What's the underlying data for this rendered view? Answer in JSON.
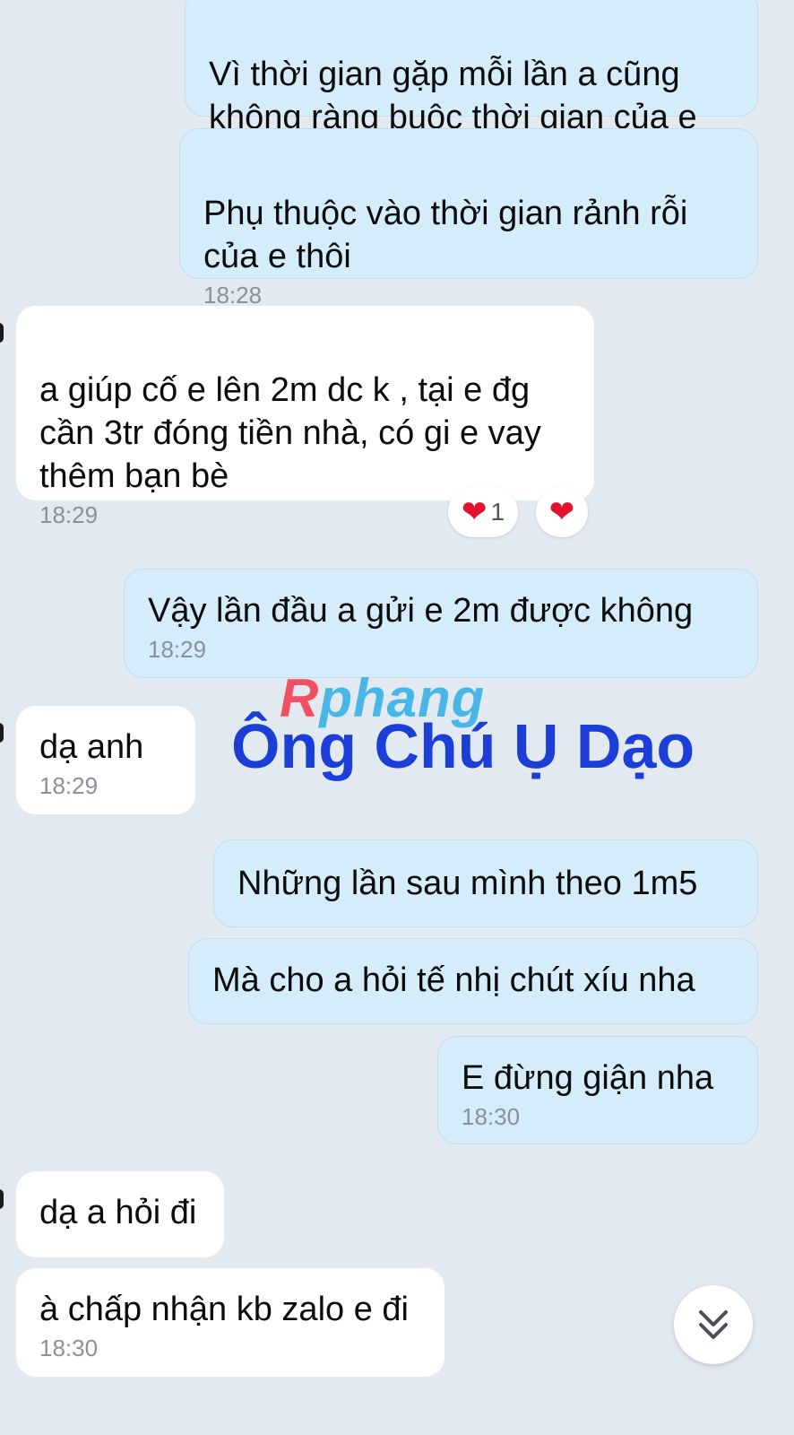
{
  "messages": [
    {
      "text": "Vì thời gian gặp mỗi lần a cũng\nkhông ràng buộc thời gian của e",
      "time": ""
    },
    {
      "text": "Phụ thuộc vào thời gian rảnh rỗi\ncủa e thôi",
      "time": "18:28"
    },
    {
      "text": "a giúp cố e lên 2m dc k , tại e đg\ncần 3tr đóng tiền nhà, có gi e vay\nthêm bạn bè",
      "time": "18:29"
    },
    {
      "text": "Vậy lần đầu a gửi e 2m được không",
      "time": "18:29"
    },
    {
      "text": "dạ anh",
      "time": "18:29"
    },
    {
      "text": "Những lần sau mình theo 1m5",
      "time": ""
    },
    {
      "text": "Mà cho a hỏi tế nhị chút xíu nha",
      "time": ""
    },
    {
      "text": "E đừng giận nha",
      "time": "18:30"
    },
    {
      "text": "dạ a hỏi đi",
      "time": ""
    },
    {
      "text": "à chấp nhận kb zalo e đi",
      "time": "18:30"
    }
  ],
  "reactions": {
    "heart_count": "1",
    "heart_icon": "heart-icon",
    "color": "#e4122b"
  },
  "watermark": {
    "brand": "Rphang",
    "title": "Ông Chú Ụ Dạo"
  },
  "scroll_button": {
    "icon": "double-chevron-down-icon"
  },
  "colors": {
    "background": "#e2e9f1",
    "sent_bubble": "#d5ecfb",
    "received_bubble": "#ffffff"
  }
}
